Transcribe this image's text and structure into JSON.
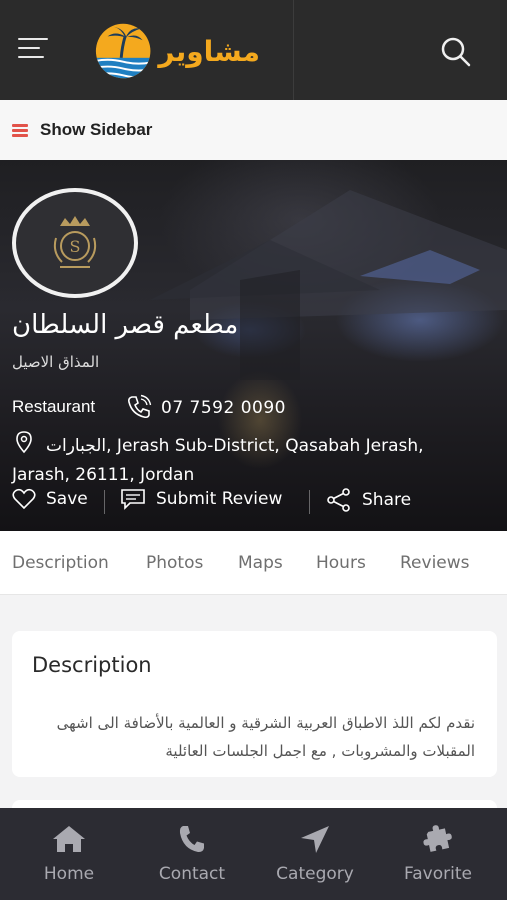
{
  "header": {
    "menu_icon": "hamburger-icon",
    "logo_text": "مشاوير",
    "search_icon": "search-icon"
  },
  "sidebar_toggle": {
    "label": "Show Sidebar",
    "icon": "bars-icon",
    "icon_color": "#e2534a"
  },
  "listing": {
    "title": "مطعم قصر السلطان",
    "subtitle": "المذاق الاصيل",
    "category": "Restaurant",
    "phone": "07 7592 0090",
    "address": "الجبارات, Jerash Sub-District, Qasabah Jerash, Jarash, 26111, Jordan",
    "actions": {
      "save": "Save",
      "submit_review": "Submit Review",
      "share": "Share"
    }
  },
  "tabs": [
    "Description",
    "Photos",
    "Maps",
    "Hours",
    "Reviews"
  ],
  "description": {
    "title": "Description",
    "body": "نقدم لكم اللذ الاطباق العربية الشرقية و العالمية بالأضافة الى اشهى المقبلات والمشروبات , مع اجمل الجلسات العائلية"
  },
  "bottom_nav": [
    {
      "label": "Home",
      "icon": "home-icon"
    },
    {
      "label": "Contact",
      "icon": "phone-icon"
    },
    {
      "label": "Category",
      "icon": "navigation-arrow-icon"
    },
    {
      "label": "Favorite",
      "icon": "puzzle-icon"
    }
  ],
  "colors": {
    "header_bg": "#2b2b2b",
    "logo": "#f4a91e",
    "nav_bg": "#2c2c33",
    "nav_text": "#a9a9b0"
  }
}
